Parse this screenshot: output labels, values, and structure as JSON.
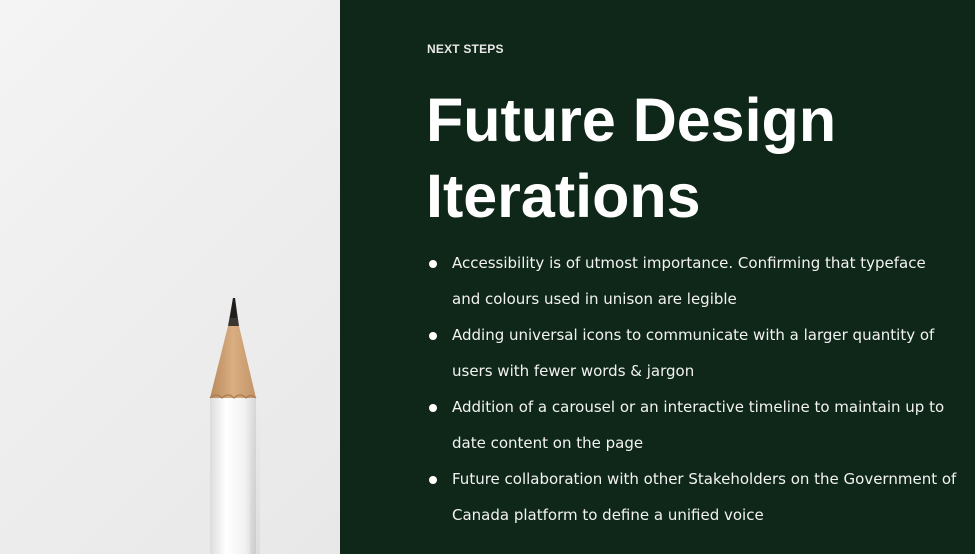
{
  "section": {
    "eyebrow": "NEXT STEPS",
    "title": "Future Design Iterations"
  },
  "bullets": [
    "Accessibility is of utmost importance. Confirming that typeface and colours used in unison are legible",
    "Adding universal icons to communicate with a larger quantity of users with fewer words & jargon",
    "Addition of a carousel or an interactive timeline to maintain up to date content on the page",
    "Future collaboration with other Stakeholders on the Government of Canada platform to define a unified voice"
  ],
  "colors": {
    "panel_background": "#0f2718",
    "text": "#ffffff",
    "left_background": "#efefef"
  },
  "image": {
    "icon": "pencil-icon"
  }
}
